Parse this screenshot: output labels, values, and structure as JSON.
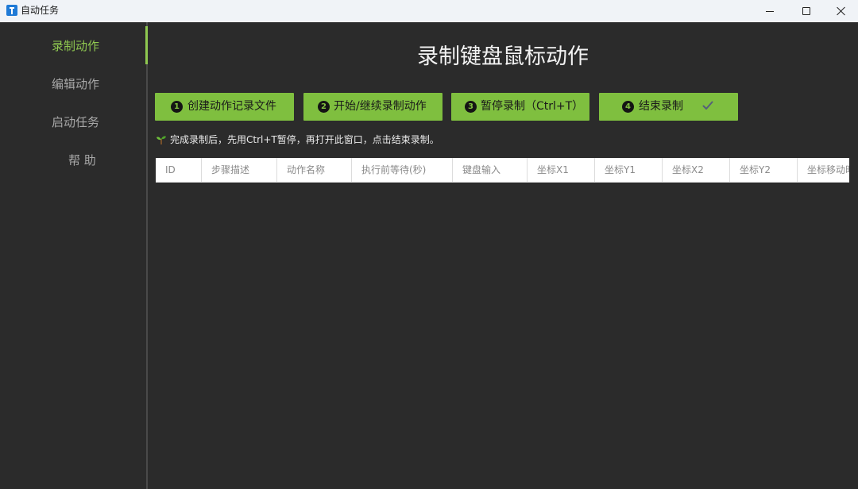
{
  "window": {
    "title": "自动任务"
  },
  "sidebar": {
    "items": [
      {
        "label": "录制动作",
        "active": true
      },
      {
        "label": "编辑动作",
        "active": false
      },
      {
        "label": "启动任务",
        "active": false
      },
      {
        "label": "帮 助",
        "active": false
      }
    ]
  },
  "main": {
    "title": "录制键盘鼠标动作",
    "buttons": [
      {
        "number": "1",
        "label": "创建动作记录文件"
      },
      {
        "number": "2",
        "label": "开始/继续录制动作"
      },
      {
        "number": "3",
        "label": "暂停录制（Ctrl+T）"
      },
      {
        "number": "4",
        "label": "结束录制"
      }
    ],
    "hint": "完成录制后，先用Ctrl+T暂停，再打开此窗口，点击结束录制。",
    "table": {
      "columns": [
        "ID",
        "步骤描述",
        "动作名称",
        "执行前等待(秒)",
        "键盘输入",
        "坐标X1",
        "坐标Y1",
        "坐标X2",
        "坐标Y2",
        "坐标移动时"
      ],
      "rows": []
    }
  },
  "colors": {
    "accent": "#7fbf3f",
    "active_nav": "#8fc850",
    "background": "#2b2b2b",
    "titlebar": "#f0f3f7"
  },
  "icons": {
    "app": "app-icon",
    "check": "check-icon",
    "hint": "sprout-icon"
  }
}
